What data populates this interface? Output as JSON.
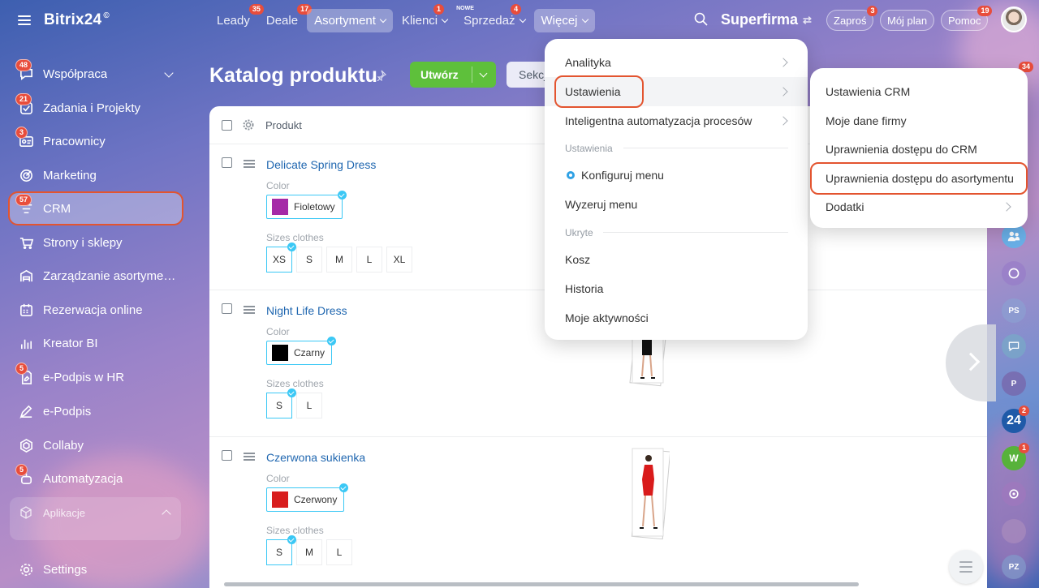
{
  "brand": {
    "name": "Bitrix24",
    "sup": "©"
  },
  "top_nav": [
    {
      "label": "Leady",
      "badge": "35"
    },
    {
      "label": "Deale",
      "badge": "17"
    },
    {
      "label": "Asortyment",
      "badge": ""
    },
    {
      "label": "Klienci",
      "badge": "1"
    },
    {
      "label": "Sprzedaż",
      "badge": "4",
      "tag": "NOWE"
    },
    {
      "label": "Więcej",
      "badge": ""
    }
  ],
  "company": {
    "name": "Superfirma",
    "switch_icon": "⇄"
  },
  "header_pills": [
    {
      "label": "Zaproś",
      "badge": "3"
    },
    {
      "label": "Mój plan",
      "badge": ""
    },
    {
      "label": "Pomoc",
      "badge": "19"
    }
  ],
  "sidebar": {
    "items": [
      {
        "label": "Współpraca",
        "badge": "48",
        "icon": "chat-icon"
      },
      {
        "label": "Zadania i Projekty",
        "badge": "21",
        "icon": "tasks-icon"
      },
      {
        "label": "Pracownicy",
        "badge": "3",
        "icon": "employees-icon"
      },
      {
        "label": "Marketing",
        "badge": "",
        "icon": "marketing-icon"
      },
      {
        "label": "CRM",
        "badge": "57",
        "icon": "crm-icon"
      },
      {
        "label": "Strony i sklepy",
        "badge": "",
        "icon": "cart-icon"
      },
      {
        "label": "Zarządzanie asortymentem",
        "badge": "",
        "icon": "warehouse-icon"
      },
      {
        "label": "Rezerwacja online",
        "badge": "",
        "icon": "calendar-icon"
      },
      {
        "label": "Kreator BI",
        "badge": "",
        "icon": "chart-icon"
      },
      {
        "label": "e-Podpis w HR",
        "badge": "5",
        "icon": "document-sign-icon"
      },
      {
        "label": "e-Podpis",
        "badge": "",
        "icon": "pen-icon"
      },
      {
        "label": "Collaby",
        "badge": "",
        "icon": "hexagon-icon"
      },
      {
        "label": "Automatyzacja",
        "badge": "5",
        "icon": "robot-icon"
      }
    ],
    "apps_label": "Aplikacje",
    "settings_label": "Settings"
  },
  "page": {
    "title": "Katalog produktu",
    "create_label": "Utwórz",
    "section_label": "Sekcj"
  },
  "table": {
    "column_product": "Produkt",
    "rows": [
      {
        "name": "Delicate Spring Dress",
        "color_label": "Color",
        "color_value": "Fioletowy",
        "color_hex": "#a52aa7",
        "sizes_label": "Sizes clothes",
        "sizes": [
          "XS",
          "S",
          "M",
          "L",
          "XL"
        ],
        "selected_size": "XS"
      },
      {
        "name": "Night Life Dress",
        "color_label": "Color",
        "color_value": "Czarny",
        "color_hex": "#000000",
        "sizes_label": "Sizes clothes",
        "sizes": [
          "S",
          "L"
        ],
        "selected_size": "S"
      },
      {
        "name": "Czerwona sukienka",
        "color_label": "Color",
        "color_value": "Czerwony",
        "color_hex": "#d81e1e",
        "sizes_label": "Sizes clothes",
        "sizes": [
          "S",
          "M",
          "L"
        ],
        "selected_size": "S"
      }
    ]
  },
  "more_menu": {
    "items": [
      {
        "label": "Analityka"
      },
      {
        "label": "Ustawienia"
      },
      {
        "label": "Inteligentna automatyzacja procesów"
      }
    ],
    "section_settings": "Ustawienia",
    "configure": "Konfiguruj menu",
    "reset": "Wyzeruj menu",
    "section_hidden": "Ukryte",
    "hidden_items": [
      {
        "label": "Kosz"
      },
      {
        "label": "Historia"
      },
      {
        "label": "Moje aktywności"
      }
    ]
  },
  "settings_submenu": {
    "items": [
      {
        "label": "Ustawienia CRM"
      },
      {
        "label": "Moje dane firmy"
      },
      {
        "label": "Uprawnienia dostępu do CRM"
      },
      {
        "label": "Uprawnienia dostępu do asortymentu"
      },
      {
        "label": "Dodatki"
      }
    ]
  },
  "right_strip": [
    {
      "label": "34",
      "kind": "badge"
    },
    {
      "label": "PS",
      "kind": "avatar"
    },
    {
      "label": "P",
      "kind": "avatar"
    },
    {
      "label": "24",
      "kind": "logo",
      "badge": "2"
    },
    {
      "label": "W",
      "kind": "app",
      "badge": "1"
    },
    {
      "label": "PZ",
      "kind": "avatar"
    }
  ],
  "colors": {
    "accent_green": "#5ec03b",
    "badge_red": "#e84d3c",
    "highlight": "#e3542f",
    "link_blue": "#2067b0",
    "check_blue": "#3bc8f5"
  }
}
